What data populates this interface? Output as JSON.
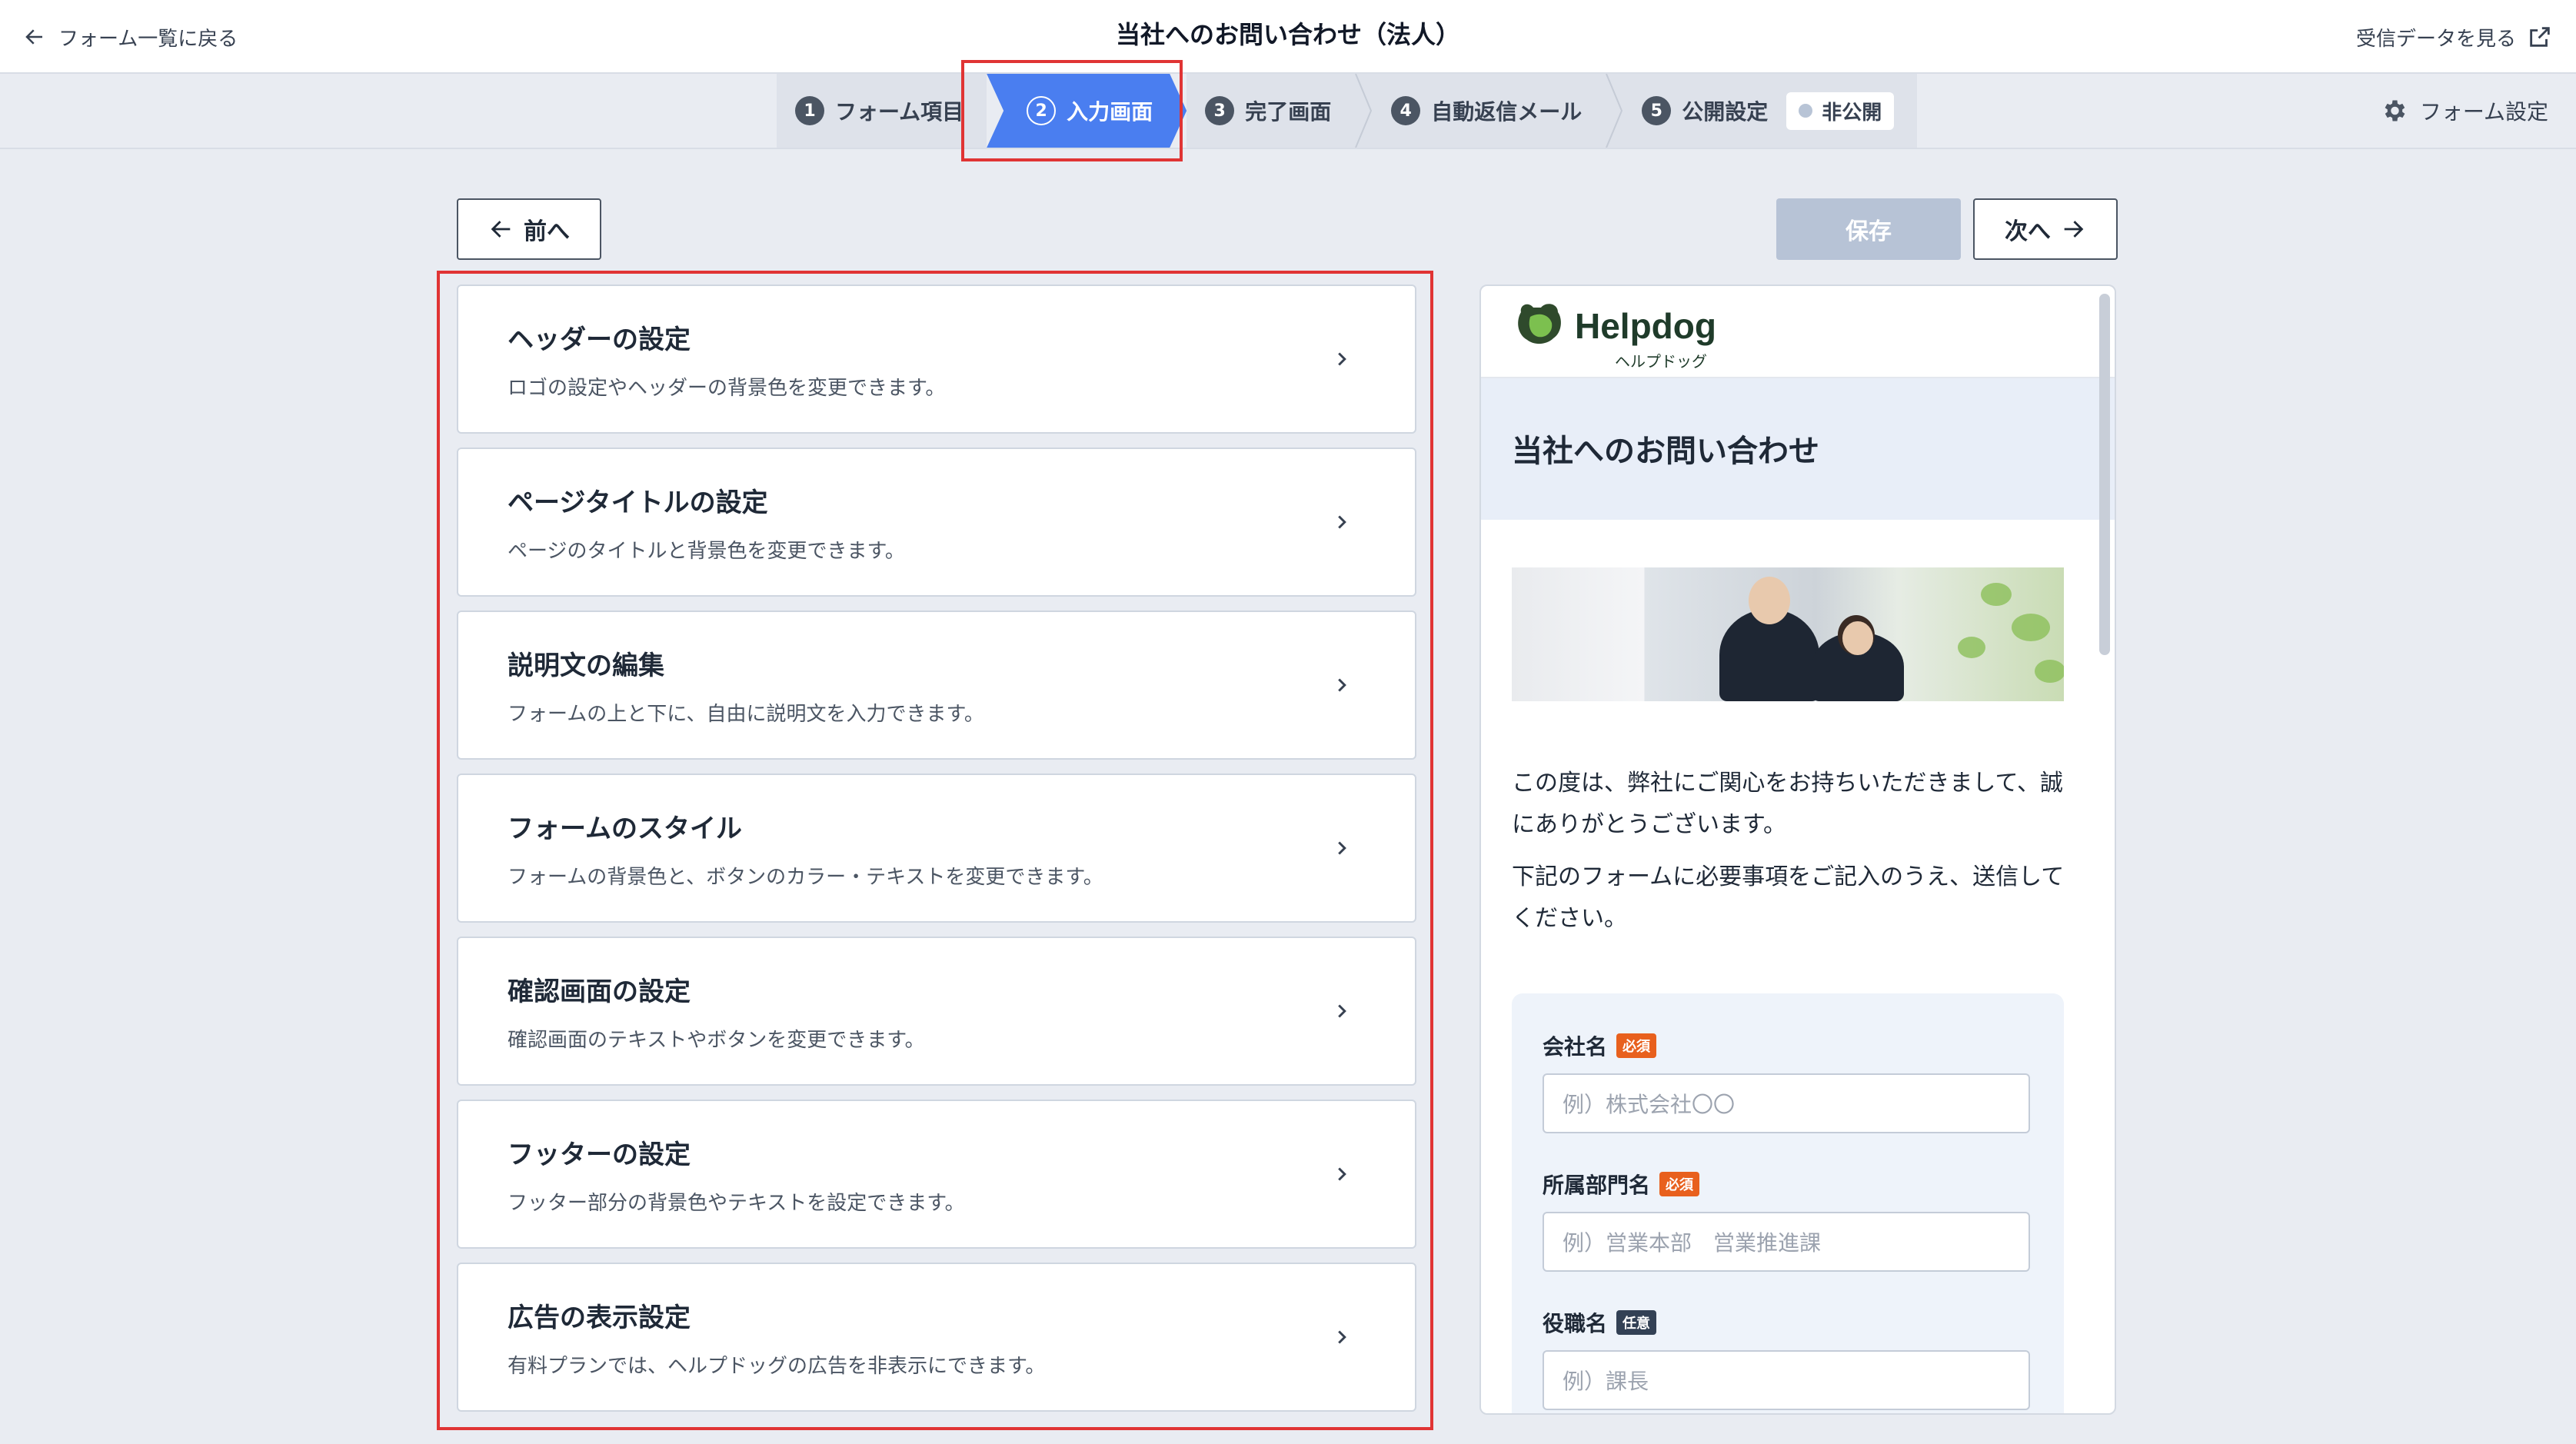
{
  "header": {
    "back_label": "フォーム一覧に戻る",
    "title": "当社へのお問い合わせ（法人）",
    "view_data_label": "受信データを見る"
  },
  "steps": [
    {
      "num": "1",
      "label": "フォーム項目"
    },
    {
      "num": "2",
      "label": "入力画面",
      "active": true
    },
    {
      "num": "3",
      "label": "完了画面"
    },
    {
      "num": "4",
      "label": "自動返信メール"
    },
    {
      "num": "5",
      "label": "公開設定"
    }
  ],
  "publish_status": "非公開",
  "form_settings_label": "フォーム設定",
  "actions": {
    "prev": "前へ",
    "save": "保存",
    "next": "次へ"
  },
  "cards": [
    {
      "title": "ヘッダーの設定",
      "desc": "ロゴの設定やヘッダーの背景色を変更できます。"
    },
    {
      "title": "ページタイトルの設定",
      "desc": "ページのタイトルと背景色を変更できます。"
    },
    {
      "title": "説明文の編集",
      "desc": "フォームの上と下に、自由に説明文を入力できます。"
    },
    {
      "title": "フォームのスタイル",
      "desc": "フォームの背景色と、ボタンのカラー・テキストを変更できます。"
    },
    {
      "title": "確認画面の設定",
      "desc": "確認画面のテキストやボタンを変更できます。"
    },
    {
      "title": "フッターの設定",
      "desc": "フッター部分の背景色やテキストを設定できます。"
    },
    {
      "title": "広告の表示設定",
      "desc": "有料プランでは、ヘルプドッグの広告を非表示にできます。"
    }
  ],
  "preview": {
    "logo_text": "Helpdog",
    "logo_sub": "ヘルプドッグ",
    "page_title": "当社へのお問い合わせ",
    "intro_1": "この度は、弊社にご関心をお持ちいただきまして、誠にありがとうございます。",
    "intro_2": "下記のフォームに必要事項をご記入のうえ、送信してください。",
    "fields": [
      {
        "label": "会社名",
        "tag": "必須",
        "placeholder": "例）株式会社〇〇"
      },
      {
        "label": "所属部門名",
        "tag": "必須",
        "placeholder": "例）営業本部　営業推進課"
      },
      {
        "label": "役職名",
        "tag": "任意",
        "placeholder": "例）課長"
      }
    ]
  },
  "colors": {
    "accent": "#4a7ef0",
    "highlight": "#e03434",
    "required": "#e8601d",
    "optional": "#334155"
  }
}
